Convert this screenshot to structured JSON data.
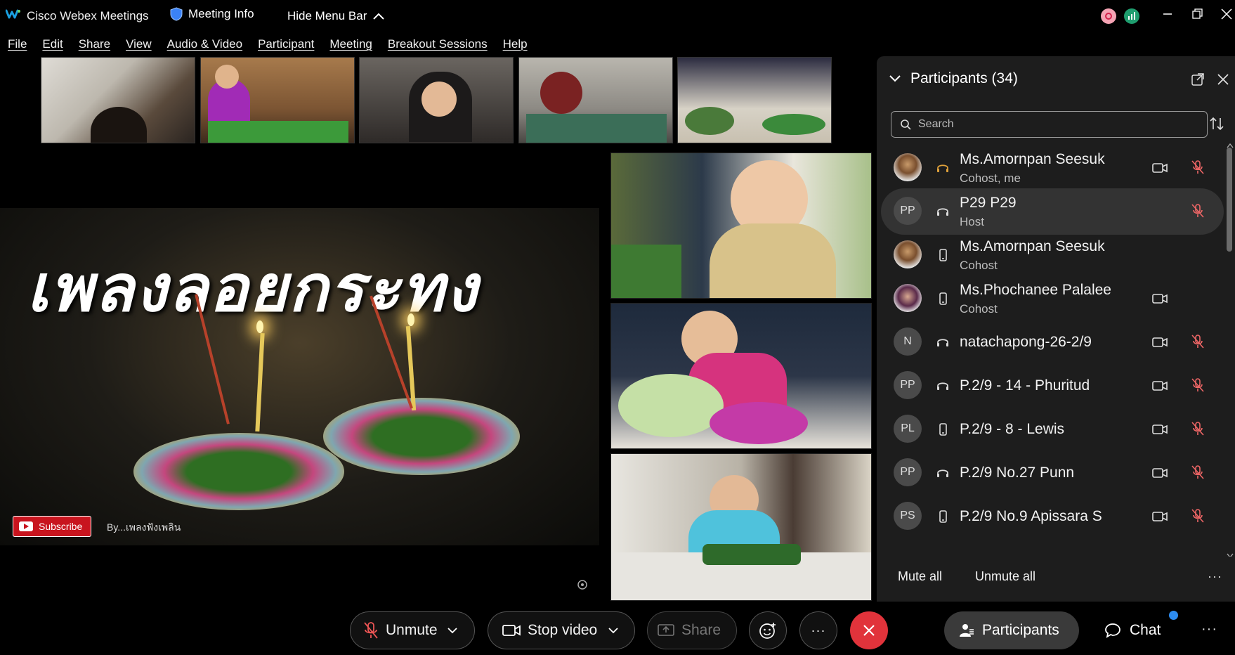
{
  "titlebar": {
    "app_title": "Cisco Webex Meetings",
    "meeting_info": "Meeting Info",
    "hide_menu_bar": "Hide Menu Bar",
    "record_color": "#d3214b",
    "signal_color": "#1f9e6f"
  },
  "menu": [
    "File",
    "Edit",
    "Share",
    "View",
    "Audio & Video",
    "Participant",
    "Meeting",
    "Breakout Sessions",
    "Help"
  ],
  "share": {
    "title_text": "เพลงลอยกระทง",
    "subscribe_label": "Subscribe",
    "byline": "By...เพลงฟังเพลิน"
  },
  "participants_panel": {
    "title": "Participants (34)",
    "search_placeholder": "Search",
    "participants": [
      {
        "name": "Ms.Amornpan Seesuk",
        "role": "Cohost, me",
        "avatar": "photo",
        "status": "headset",
        "camera": true,
        "mic": "muted"
      },
      {
        "name": "P29 P29",
        "role": "Host",
        "avatar": "PP",
        "status": "headset",
        "camera": false,
        "mic": "muted"
      },
      {
        "name": "Ms.Amornpan Seesuk",
        "role": "Cohost",
        "avatar": "photo",
        "status": "phone",
        "camera": false,
        "mic": "none"
      },
      {
        "name": "Ms.Phochanee Palalee",
        "role": "Cohost",
        "avatar": "photo2",
        "status": "phone",
        "camera": true,
        "mic": "none"
      },
      {
        "name": "natachapong-26-2/9",
        "role": "",
        "avatar": "N",
        "status": "headset",
        "camera": true,
        "mic": "muted"
      },
      {
        "name": "P.2/9 - 14 - Phuritud",
        "role": "",
        "avatar": "PP",
        "status": "headset",
        "camera": true,
        "mic": "muted"
      },
      {
        "name": "P.2/9 - 8 - Lewis",
        "role": "",
        "avatar": "PL",
        "status": "phone",
        "camera": true,
        "mic": "muted"
      },
      {
        "name": "P.2/9 No.27 Punn",
        "role": "",
        "avatar": "PP",
        "status": "headset",
        "camera": true,
        "mic": "muted"
      },
      {
        "name": "P.2/9 No.9 Apissara S",
        "role": "",
        "avatar": "PS",
        "status": "phone",
        "camera": true,
        "mic": "muted"
      }
    ],
    "mute_all": "Mute all",
    "unmute_all": "Unmute all",
    "more": "···"
  },
  "controls": {
    "unmute": "Unmute",
    "stop_video": "Stop video",
    "share": "Share",
    "more": "···",
    "participants": "Participants",
    "chat": "Chat",
    "end_color": "#e1333b"
  }
}
